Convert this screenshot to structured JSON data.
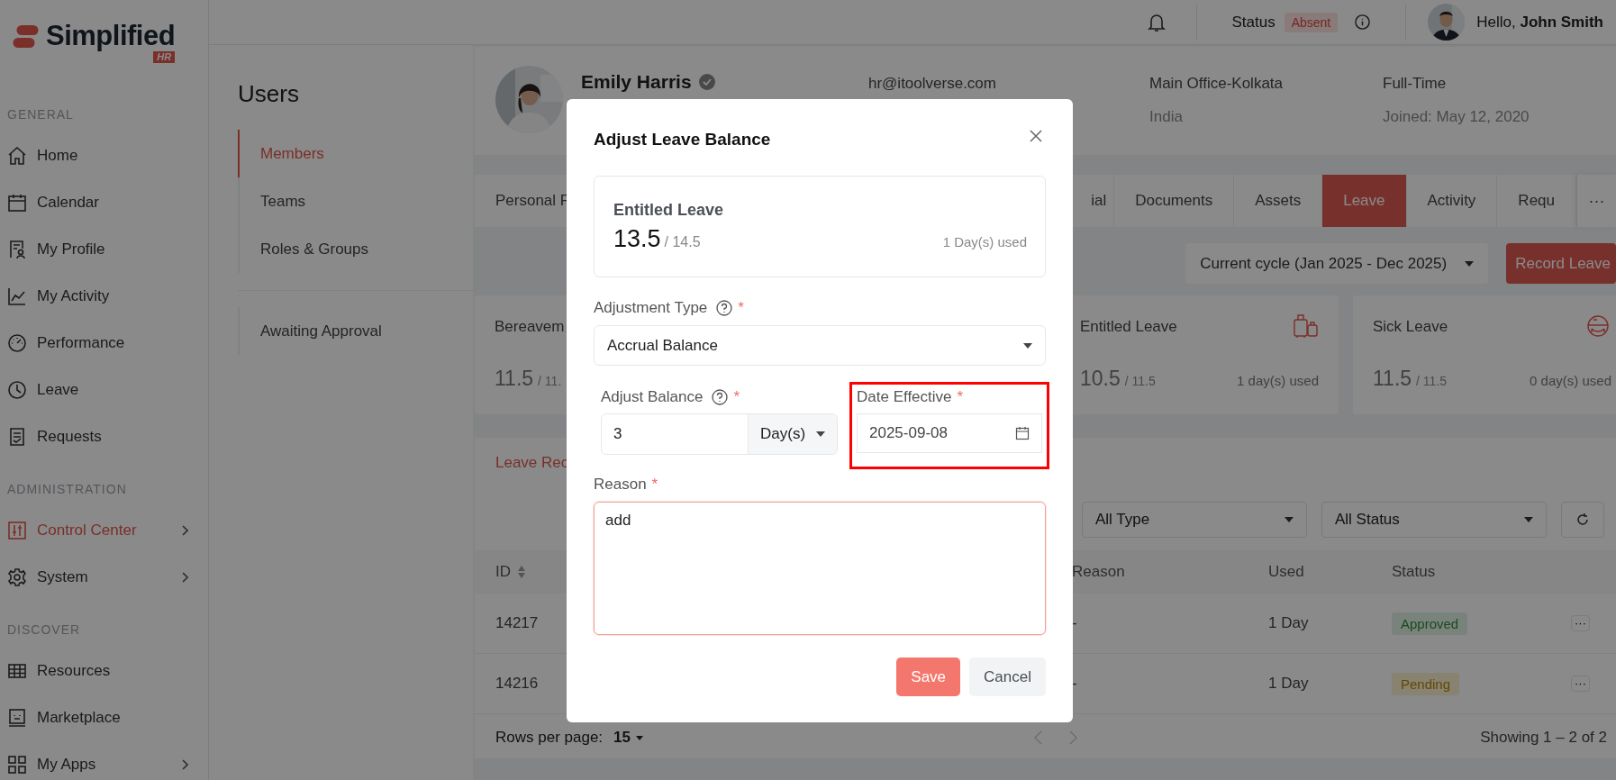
{
  "sidebar": {
    "logo": {
      "wordmark": "Simplified",
      "badge": "HR"
    },
    "sections": [
      {
        "heading": "GENERAL",
        "items": [
          {
            "label": "Home",
            "selected": false,
            "expandable": false
          },
          {
            "label": "Calendar",
            "selected": false,
            "expandable": false
          },
          {
            "label": "My Profile",
            "selected": false,
            "expandable": false
          },
          {
            "label": "My Activity",
            "selected": false,
            "expandable": false
          },
          {
            "label": "Performance",
            "selected": false,
            "expandable": false
          },
          {
            "label": "Leave",
            "selected": false,
            "expandable": false
          },
          {
            "label": "Requests",
            "selected": false,
            "expandable": false
          }
        ]
      },
      {
        "heading": "ADMINISTRATION",
        "items": [
          {
            "label": "Control Center",
            "selected": true,
            "expandable": true
          },
          {
            "label": "System",
            "selected": false,
            "expandable": true
          }
        ]
      },
      {
        "heading": "DISCOVER",
        "items": [
          {
            "label": "Resources",
            "selected": false,
            "expandable": false
          },
          {
            "label": "Marketplace",
            "selected": false,
            "expandable": false
          },
          {
            "label": "My Apps",
            "selected": false,
            "expandable": true
          }
        ]
      }
    ]
  },
  "header": {
    "status_label": "Status",
    "status": "Absent",
    "greeting": "Hello, **John Smith**"
  },
  "subnav": {
    "title": "Users",
    "groups": [
      {
        "items": [
          {
            "label": "Members",
            "selected": true
          },
          {
            "label": "Teams",
            "selected": false
          },
          {
            "label": "Roles & Groups",
            "selected": false
          }
        ]
      },
      {
        "items": [
          {
            "label": "Awaiting Approval",
            "selected": false
          }
        ]
      }
    ]
  },
  "profile": {
    "name": "Emily Harris",
    "verified": true,
    "email": "hr@itoolverse.com",
    "location": "Main Office-Kolkata",
    "country": "India",
    "employment": "Full-Time",
    "joined": "Joined: May 12, 2020"
  },
  "tabs": [
    {
      "label": "Personal F",
      "selected": false
    },
    {
      "label": "ial",
      "selected": false
    },
    {
      "label": "Documents",
      "selected": false
    },
    {
      "label": "Assets",
      "selected": false
    },
    {
      "label": "Leave",
      "selected": true
    },
    {
      "label": "Activity",
      "selected": false
    },
    {
      "label": "Requ",
      "selected": false
    }
  ],
  "tabs_more": "···",
  "cycle_select": "Current cycle (Jan 2025 - Dec 2025)",
  "record_button": "Record Leave",
  "leave_cards": [
    {
      "title": "Bereavem",
      "balance": "11.5",
      "total": "/ 11."
    },
    {
      "title": "Entitled Leave",
      "balance": "10.5",
      "total": "/ 11.5",
      "used": "1 day(s) used"
    },
    {
      "title": "Sick Leave",
      "balance": "11.5",
      "total": "/ 11.5",
      "used": "0 day(s) used"
    }
  ],
  "records": {
    "tab": "Leave Rec",
    "filters": [
      "All Type",
      "All Status"
    ],
    "columns": [
      "ID",
      "Reason",
      "Used",
      "Status"
    ],
    "rows": [
      {
        "id": "14217",
        "reason": "-",
        "used": "1 Day",
        "status": "Approved",
        "kind": "approved",
        "actions": "···"
      },
      {
        "id": "14216",
        "reason": "-",
        "used": "1 Day",
        "status": "Pending",
        "kind": "pending",
        "actions": "···"
      }
    ],
    "rows_per_page_label": "Rows per page:",
    "rows_per_page": "15",
    "showing": "Showing 1 – 2 of 2"
  },
  "modal": {
    "title": "Adjust Leave Balance",
    "summary": {
      "title": "Entitled Leave",
      "balance": "13.5",
      "total": "/ 14.5",
      "used": "1 Day(s) used"
    },
    "adjustment_type": {
      "label": "Adjustment Type",
      "help": true,
      "required_mark": "*",
      "value": "Accrual Balance"
    },
    "adjust_balance": {
      "label": "Adjust Balance",
      "help": true,
      "required_mark": "*",
      "value": "3",
      "unit": "Day(s)"
    },
    "date_effective": {
      "label": "Date Effective",
      "required_mark": "*",
      "value": "2025-09-08",
      "highlighted": true
    },
    "reason": {
      "label": "Reason",
      "required_mark": "*",
      "value": "add"
    },
    "buttons": [
      {
        "label": "Save",
        "kind": "primary"
      },
      {
        "label": "Cancel",
        "kind": "secondary"
      }
    ]
  }
}
